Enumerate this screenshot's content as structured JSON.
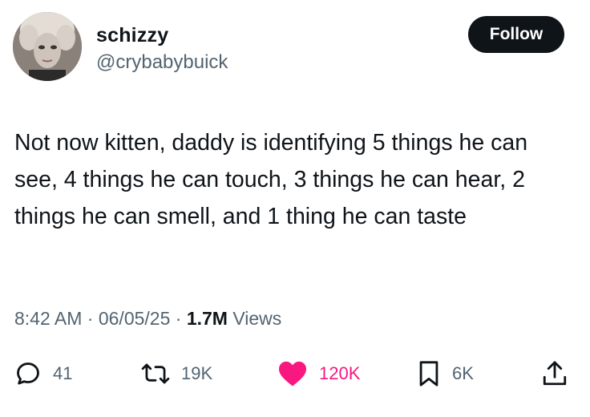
{
  "user": {
    "display_name": "schizzy",
    "handle": "@crybabybuick"
  },
  "follow_label": "Follow",
  "tweet": {
    "text": "Not now kitten, daddy is identifying 5 things he can see, 4 things he can touch, 3 things he can hear, 2 things he can smell, and 1 thing he can taste"
  },
  "meta": {
    "time": "8:42 AM",
    "sep1": " · ",
    "date": "06/05/25",
    "sep2": " · ",
    "views_count": "1.7M",
    "views_label": " Views"
  },
  "actions": {
    "replies": "41",
    "reposts": "19K",
    "likes": "120K",
    "bookmarks": "6K"
  },
  "colors": {
    "text": "#0f1419",
    "muted": "#536471",
    "like": "#f91880",
    "button_bg": "#0f1419"
  },
  "icons": [
    "reply-icon",
    "retweet-icon",
    "heart-icon",
    "bookmark-icon",
    "share-icon"
  ]
}
